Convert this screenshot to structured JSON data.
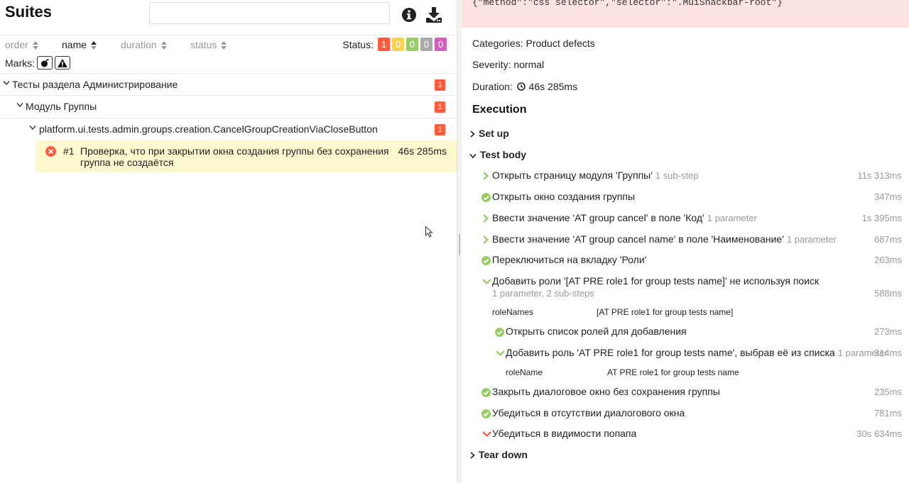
{
  "header": {
    "title": "Suites",
    "search_value": "",
    "search_placeholder": ""
  },
  "icons": {
    "info": "info-icon",
    "download": "download-icon",
    "fail": "failed-status-icon",
    "passed": "passed-status-icon",
    "chevron": "chevron-icon",
    "flaky_mark": "bomb-icon",
    "known_issue_mark": "warning-icon",
    "timer": "clock-icon"
  },
  "colors": {
    "failed": "#fd5a3e",
    "broken": "#ffd050",
    "passed": "#97cc64",
    "skipped": "#aaaaaa",
    "unknown": "#d35ebe",
    "selected_row": "#fef8cf",
    "error_bg": "#fde2e2"
  },
  "sort": {
    "order": "order",
    "name": "name",
    "duration": "duration",
    "status": "status"
  },
  "status_filter": {
    "label": "Status:",
    "counts": [
      {
        "status": "failed",
        "value": "1"
      },
      {
        "status": "broken",
        "value": "0"
      },
      {
        "status": "passed",
        "value": "0"
      },
      {
        "status": "skipped",
        "value": "0"
      },
      {
        "status": "unknown",
        "value": "0"
      }
    ]
  },
  "marks": {
    "label": "Marks:"
  },
  "tree": {
    "suite": {
      "name": "Тесты раздела Администрирование",
      "count": "1"
    },
    "module": {
      "name": "Модуль Группы",
      "count": "1"
    },
    "class": {
      "name": "platform.ui.tests.admin.groups.creation.CancelGroupCreationViaCloseButton",
      "count": "1"
    },
    "test": {
      "number": "#1",
      "name": "Проверка, что при закрытии окна создания группы без сохранения группа не создаётся",
      "duration": "46s 285ms"
    }
  },
  "details": {
    "error_text": "{\"method\":\"css selector\",\"selector\":\".MuiSnackbar-root\"}",
    "categories": "Categories: Product defects",
    "severity": "Severity: normal",
    "duration_label": "Duration:",
    "duration_value": "46s 285ms",
    "execution_title": "Execution",
    "setup_label": "Set up",
    "testbody_label": "Test body",
    "teardown_label": "Tear down"
  },
  "steps": [
    {
      "name": "Открыть страницу модуля 'Группы'",
      "sub": "1 sub-step",
      "duration": "11s 313ms"
    },
    {
      "name": "Открыть окно создания группы",
      "sub": "",
      "duration": "347ms"
    },
    {
      "name": "Ввести значение 'AT group cancel' в поле 'Код'",
      "sub": "1 parameter",
      "duration": "1s 395ms"
    },
    {
      "name": "Ввести значение 'AT group cancel name' в поле 'Наименование'",
      "sub": "1 parameter",
      "duration": "687ms"
    },
    {
      "name": "Переключиться на вкладку 'Роли'",
      "sub": "",
      "duration": "263ms"
    },
    {
      "name": "Добавить роли '[AT PRE role1 for group tests name]' не используя поиск",
      "sub": "1 parameter, 2 sub-steps",
      "duration": "588ms"
    },
    {
      "name": "Открыть список ролей для добавления",
      "sub": "",
      "duration": "273ms"
    },
    {
      "name": "Добавить роль 'AT PRE role1 for group tests name', выбрав её из списка",
      "sub": "1 parameter",
      "duration": "314ms"
    },
    {
      "name": "Закрыть диалоговое окно без сохранения группы",
      "sub": "",
      "duration": "235ms"
    },
    {
      "name": "Убедиться в отсутствии диалогового окна",
      "sub": "",
      "duration": "781ms"
    },
    {
      "name": "Убедиться в видимости попапа",
      "sub": "",
      "duration": "30s 634ms"
    }
  ],
  "params": [
    {
      "name": "roleNames",
      "value": "[AT PRE role1 for group tests name]"
    },
    {
      "name": "roleName",
      "value": "AT PRE role1 for group tests name"
    }
  ]
}
